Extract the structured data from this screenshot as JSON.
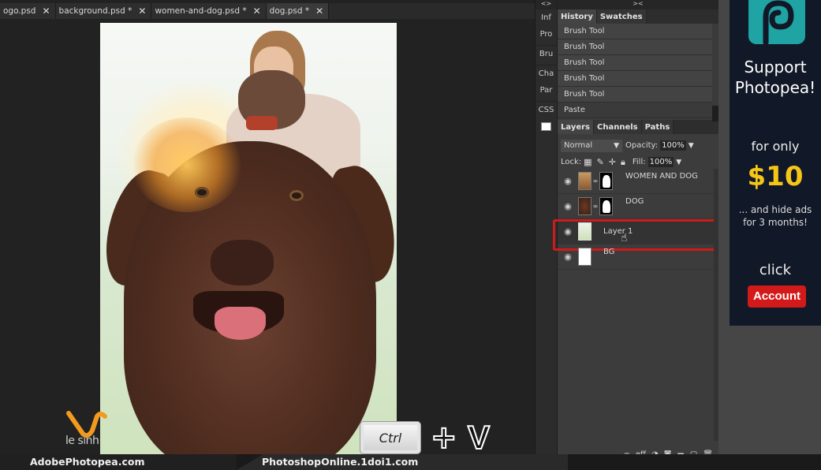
{
  "tabs": [
    {
      "label": "ogo.psd",
      "active": false
    },
    {
      "label": "background.psd *",
      "active": false
    },
    {
      "label": "women-and-dog.psd *",
      "active": false
    },
    {
      "label": "dog.psd *",
      "active": true
    }
  ],
  "close_glyph": "✕",
  "side_collapsed": {
    "header": "<>",
    "items": [
      "Inf",
      "Pro",
      "Bru",
      "Cha",
      "Par",
      "CSS"
    ]
  },
  "panel_header": "><",
  "history_panel": {
    "tabs": [
      "History",
      "Swatches"
    ],
    "items": [
      "Brush Tool",
      "Brush Tool",
      "Brush Tool",
      "Brush Tool",
      "Brush Tool",
      "Paste"
    ]
  },
  "layers_panel": {
    "tabs": [
      "Layers",
      "Channels",
      "Paths"
    ],
    "blend_mode": "Normal",
    "opacity_label": "Opacity:",
    "opacity_value": "100%",
    "lock_label": "Lock:",
    "fill_label": "Fill:",
    "fill_value": "100%",
    "layers": [
      {
        "name": "WOMEN AND DOG",
        "has_mask": true,
        "visible": true
      },
      {
        "name": "DOG",
        "has_mask": true,
        "visible": true
      },
      {
        "name": "Layer 1",
        "has_mask": false,
        "visible": true,
        "selected": true
      },
      {
        "name": "BG",
        "has_mask": false,
        "visible": true
      }
    ],
    "footer_icons": [
      "link-icon",
      "effects-icon",
      "adjustment-icon",
      "mask-icon",
      "folder-icon",
      "new-layer-icon",
      "trash-icon"
    ],
    "footer_effects_label": "eff"
  },
  "ad": {
    "title_line1": "Support",
    "title_line2": "Photopea!",
    "subtitle": "for only",
    "price": "$10",
    "hide_line1": "... and hide ads",
    "hide_line2": "for 3 months!",
    "click": "click",
    "button": "Account",
    "accent": "#f5c518",
    "button_color": "#d31a1a"
  },
  "overlay": {
    "watermark": "le sinh",
    "key1": "Ctrl",
    "plus": "+",
    "key2": "V"
  },
  "footer": {
    "left": "AdobePhotopea.com",
    "right": "PhotoshopOnline.1doi1.com"
  }
}
